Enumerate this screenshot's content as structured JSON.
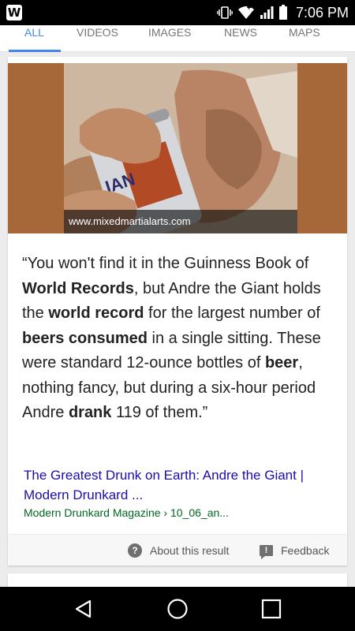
{
  "status_bar": {
    "app_badge": "W",
    "time": "7:06 PM",
    "icons": [
      "vibrate-icon",
      "wifi-icon",
      "signal-icon",
      "battery-icon"
    ]
  },
  "tabs": [
    {
      "label": "ALL",
      "active": true
    },
    {
      "label": "VIDEOS",
      "active": false
    },
    {
      "label": "IMAGES",
      "active": false
    },
    {
      "label": "NEWS",
      "active": false
    },
    {
      "label": "MAPS",
      "active": false
    }
  ],
  "result": {
    "image_source": "www.mixedmartialarts.com",
    "quote": [
      {
        "text": "“You won't find it in the Guinness Book of ",
        "bold": false
      },
      {
        "text": "World Records",
        "bold": true
      },
      {
        "text": ", but Andre the Giant holds the ",
        "bold": false
      },
      {
        "text": "world record",
        "bold": true
      },
      {
        "text": " for the largest number of ",
        "bold": false
      },
      {
        "text": "beers consumed",
        "bold": true
      },
      {
        "text": " in a single sitting. These were standard 12-ounce bottles of ",
        "bold": false
      },
      {
        "text": "beer",
        "bold": true
      },
      {
        "text": ", nothing fancy, but during a six-hour period Andre ",
        "bold": false
      },
      {
        "text": "drank",
        "bold": true
      },
      {
        "text": " 119 of them.”",
        "bold": false
      }
    ],
    "title": "The Greatest Drunk on Earth: Andre the Giant | Modern Drunkard ...",
    "source": "Modern Drunkard Magazine › 10_06_an..."
  },
  "footer": {
    "about_label": "About this result",
    "feedback_label": "Feedback"
  },
  "colors": {
    "tab_active": "#4285f4",
    "link": "#1a0dab",
    "source": "#006621",
    "image_bg": "#a66838"
  }
}
